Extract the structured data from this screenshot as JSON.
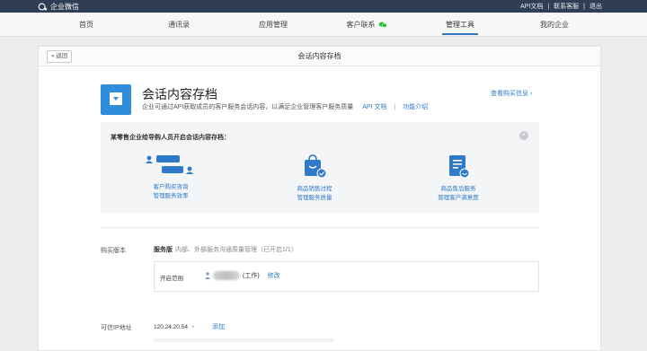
{
  "topbar": {
    "brand": "企业微信",
    "links": [
      "API文档",
      "联系客服",
      "退出"
    ]
  },
  "nav": {
    "items": [
      "首页",
      "通讯录",
      "应用管理",
      "客户联系",
      "管理工具",
      "我的企业"
    ],
    "active": "管理工具"
  },
  "card": {
    "back_label": "« 返回",
    "title": "会话内容存档"
  },
  "app": {
    "icon": "download-box-icon",
    "title": "会话内容存档",
    "description": "企业可通过API获取成员的客户服务会话内容，以满足企业管理客户服务质量",
    "api_link": "API 文档",
    "separator": "|",
    "intro_link": "功能介绍",
    "purchase_link": "查看购买信息 ›"
  },
  "promo": {
    "title": "某零售企业给导购人员开启会话内容存档：",
    "features": [
      {
        "icon": "chat-users-icon",
        "line1": "客户购买咨询",
        "line2": "管理服务效率"
      },
      {
        "icon": "shopping-bag-icon",
        "line1": "商品销售过程",
        "line2": "管理服务质量"
      },
      {
        "icon": "document-smile-icon",
        "line1": "商品售后服务",
        "line2": "管理客户满意度"
      }
    ]
  },
  "purchase": {
    "label": "购买版本",
    "edition": "服务版",
    "edition_desc": "内部、外部服务沟通质量管理（已开启1/1）",
    "scope_label": "开启范围",
    "user_suffix": "(工作)",
    "edit_link": "修改"
  },
  "ip": {
    "label": "可信IP地址",
    "value": "120.24.20.54",
    "remove": "×",
    "add_link": "添加"
  },
  "colors": {
    "topbar": "#2f3e54",
    "accent": "#2e79c8",
    "icon_blue": "#2e8edb"
  }
}
